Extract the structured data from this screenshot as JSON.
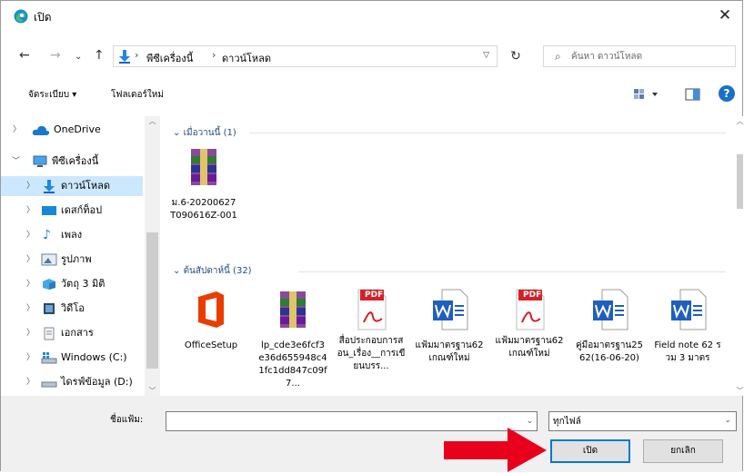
{
  "window": {
    "title": "เปิด",
    "close_label": "✕"
  },
  "address": {
    "crumbs": [
      "พีซีเครื่องนี้",
      "ดาวน์โหลด"
    ],
    "search_placeholder": "ค้นหา ดาวน์โหลด"
  },
  "toolbar": {
    "organize_label": "จัดระเบียบ ▾",
    "new_folder_label": "โฟลเดอร์ใหม่"
  },
  "nav": {
    "items": [
      {
        "label": "OneDrive",
        "icon": "cloud-icon"
      },
      {
        "label": "พีซีเครื่องนี้",
        "icon": "pc-icon"
      },
      {
        "label": "ดาวน์โหลด",
        "icon": "download-icon",
        "selected": true
      },
      {
        "label": "เดสก์ท็อป",
        "icon": "desktop-icon"
      },
      {
        "label": "เพลง",
        "icon": "music-icon"
      },
      {
        "label": "รูปภาพ",
        "icon": "pictures-icon"
      },
      {
        "label": "วัตถุ 3 มิติ",
        "icon": "3d-objects-icon"
      },
      {
        "label": "วิดีโอ",
        "icon": "video-icon"
      },
      {
        "label": "เอกสาร",
        "icon": "documents-icon"
      },
      {
        "label": "Windows (C:)",
        "icon": "drive-icon"
      },
      {
        "label": "ไดรฟ์ข้อมูล (D:)",
        "icon": "drive-icon"
      }
    ]
  },
  "groups": [
    {
      "header": "เมื่อวานนี้ (1)",
      "files": [
        {
          "name": "ม.6-20200627T090616Z-001",
          "icon": "winrar-archive-icon"
        }
      ]
    },
    {
      "header": "ต้นสัปดาห์นี้ (32)",
      "files": [
        {
          "name": "OfficeSetup",
          "icon": "office-icon"
        },
        {
          "name": "lp_cde3e6fcf3e36d655948c41fc1dd847c09f7...",
          "icon": "winrar-archive-icon"
        },
        {
          "name": "สื่อประกอบการสอน_เรื่อง__การเขียนบรร...",
          "icon": "pdf-icon",
          "badge": "PDF"
        },
        {
          "name": "แฟ้มมาตรฐาน62เกณฑ์ใหม่",
          "icon": "word-doc-icon"
        },
        {
          "name": "แฟ้มมาตรฐาน62เกณฑ์ใหม่",
          "icon": "pdf-icon",
          "badge": "PDF"
        },
        {
          "name": "คู่มือมาตรฐาน2562(16-06-20)",
          "icon": "word-doc-icon"
        },
        {
          "name": "Field note 62 รวม 3 มาตร",
          "icon": "word-doc-icon"
        }
      ]
    }
  ],
  "footer": {
    "filename_label": "ชื่อแฟ้ม:",
    "filename_value": "",
    "filetype_value": "ทุกไฟล์",
    "open_label": "เปิด",
    "cancel_label": "ยกเลิก"
  },
  "colors": {
    "accent": "#0078d7",
    "selection": "#cce8ff",
    "annotation_arrow": "#e8001c"
  }
}
